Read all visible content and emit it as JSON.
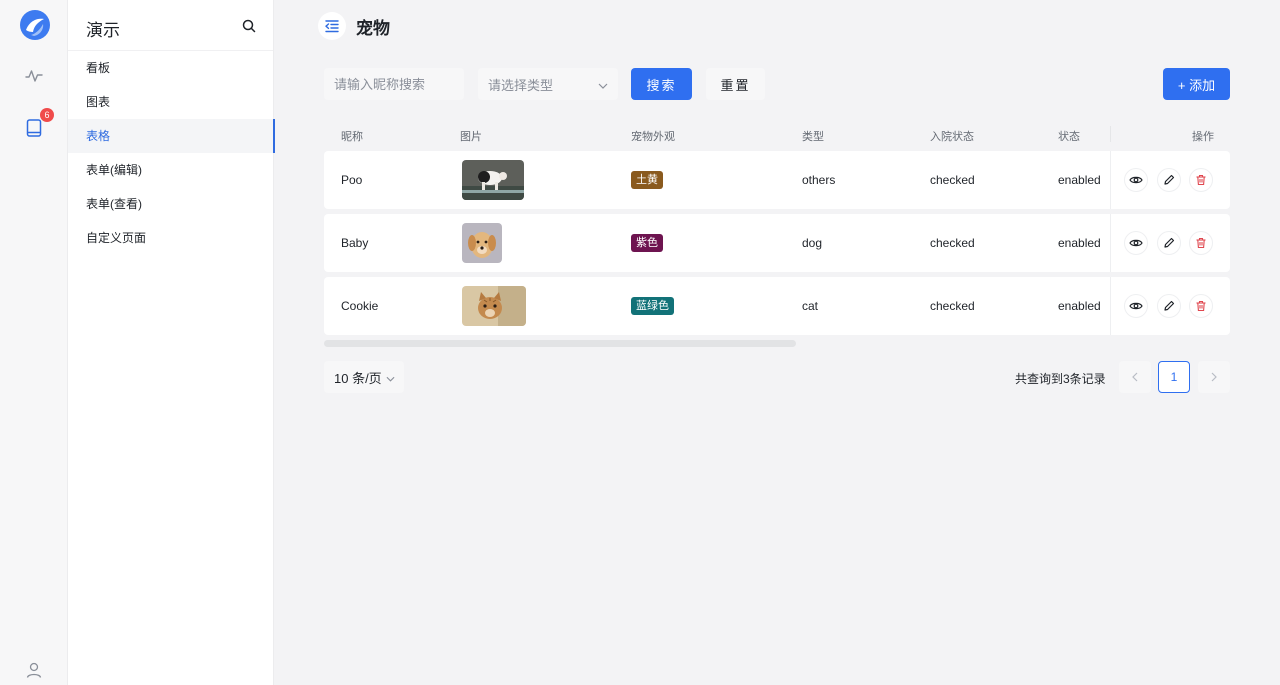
{
  "sidebar": {
    "title": "演示",
    "items": [
      {
        "label": "看板"
      },
      {
        "label": "图表"
      },
      {
        "label": "表格"
      },
      {
        "label": "表单(编辑)"
      },
      {
        "label": "表单(查看)"
      },
      {
        "label": "自定义页面"
      }
    ],
    "active_index": 2
  },
  "rail": {
    "badge_count": "6",
    "icons": [
      "app-logo-icon",
      "activity-icon",
      "book-icon",
      "user-icon"
    ]
  },
  "page": {
    "title": "宠物"
  },
  "filters": {
    "nickname_placeholder": "请输入昵称搜索",
    "type_placeholder": "请选择类型",
    "search_label": "搜索",
    "reset_label": "重置",
    "add_label": "+ 添加"
  },
  "table": {
    "columns": [
      "昵称",
      "图片",
      "宠物外观",
      "类型",
      "入院状态",
      "状态",
      "操作"
    ],
    "rows": [
      {
        "nickname": "Poo",
        "appearance": "土黄",
        "appearance_color": "#8a5a1e",
        "type": "others",
        "admission": "checked",
        "status": "enabled",
        "image": "pig-photo"
      },
      {
        "nickname": "Baby",
        "appearance": "紫色",
        "appearance_color": "#6e1450",
        "type": "dog",
        "admission": "checked",
        "status": "enabled",
        "image": "puppy-photo"
      },
      {
        "nickname": "Cookie",
        "appearance": "蓝绿色",
        "appearance_color": "#127278",
        "type": "cat",
        "admission": "checked",
        "status": "enabled",
        "image": "kitten-photo"
      }
    ]
  },
  "pagination": {
    "page_size_label": "10 条/页",
    "total_label": "共查询到3条记录",
    "current_page": "1"
  },
  "colors": {
    "primary": "#2f6ff0",
    "badge": "#f04b4b",
    "delete": "#e0474f"
  }
}
